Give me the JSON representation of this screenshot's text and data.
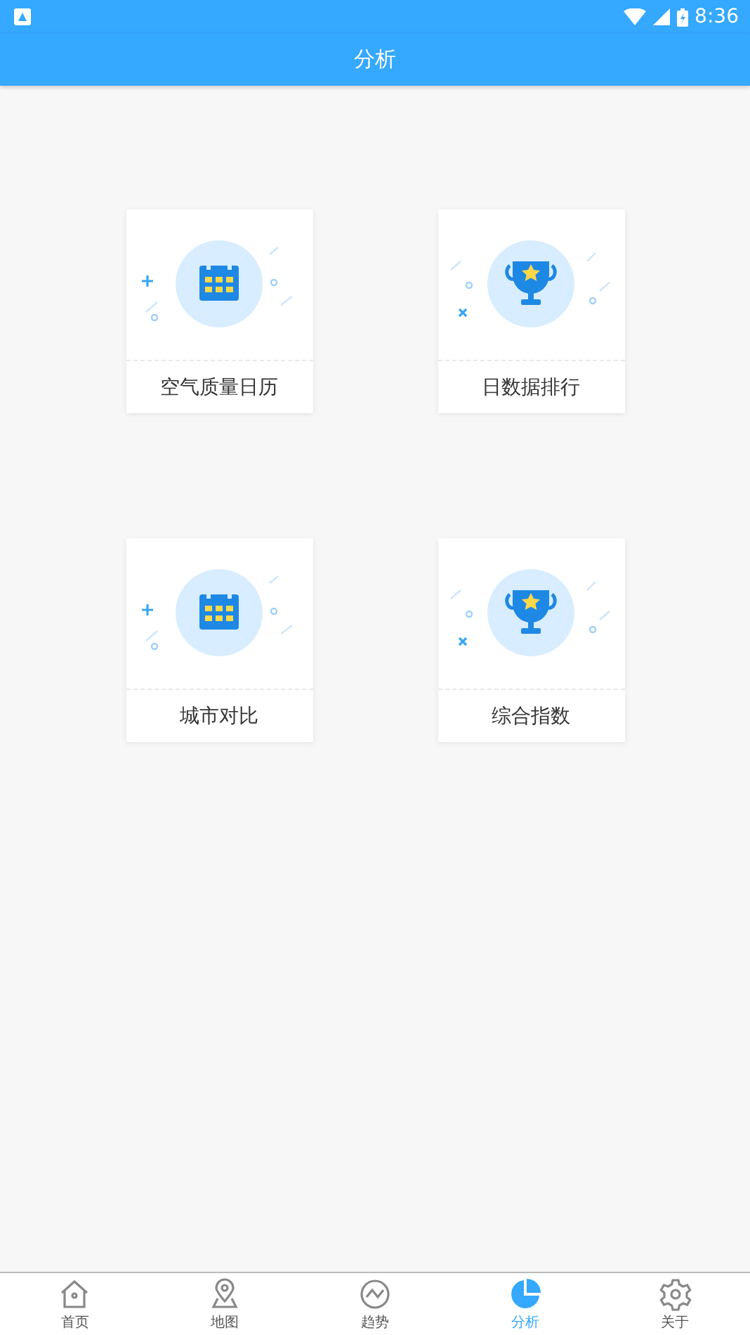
{
  "status_bar": {
    "time": "8:36"
  },
  "header": {
    "title": "分析"
  },
  "cards": [
    {
      "label": "空气质量日历",
      "kind": "calendar"
    },
    {
      "label": "日数据排行",
      "kind": "trophy"
    },
    {
      "label": "城市对比",
      "kind": "calendar"
    },
    {
      "label": "综合指数",
      "kind": "trophy"
    }
  ],
  "tabs": [
    {
      "label": "首页",
      "kind": "home",
      "selected": false
    },
    {
      "label": "地图",
      "kind": "map",
      "selected": false
    },
    {
      "label": "趋势",
      "kind": "trend",
      "selected": false
    },
    {
      "label": "分析",
      "kind": "analysis",
      "selected": true
    },
    {
      "label": "关于",
      "kind": "about",
      "selected": false
    }
  ]
}
